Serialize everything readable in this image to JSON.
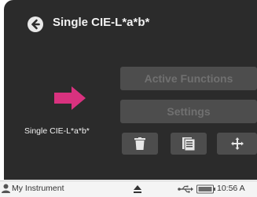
{
  "header": {
    "title": "Single CIE-L*a*b*",
    "back_icon": "back-arrow-icon"
  },
  "main": {
    "measure_label": "Single CIE-L*a*b*",
    "arrow_icon": "pink-arrow-icon",
    "buttons": {
      "active_functions": "Active Functions",
      "settings": "Settings"
    },
    "icon_buttons": [
      "trash-icon",
      "document-icon",
      "move-icon"
    ]
  },
  "statusbar": {
    "user": "My Instrument",
    "time": "10:56 A",
    "icons": [
      "user-icon",
      "eject-icon",
      "usb-icon",
      "battery-icon"
    ]
  },
  "colors": {
    "screen_bg": "#2b2b2b",
    "button_bg": "#4d4d4d",
    "button_text": "#707070",
    "accent_pink": "#d9327f"
  }
}
